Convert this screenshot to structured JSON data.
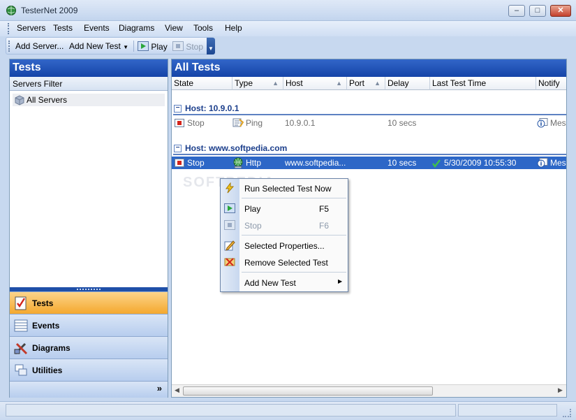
{
  "window": {
    "title": "TesterNet 2009",
    "min_label": "–",
    "max_label": "□",
    "close_label": "✕"
  },
  "menubar": {
    "items": [
      {
        "label": "Servers"
      },
      {
        "label": "Tests"
      },
      {
        "label": "Events"
      },
      {
        "label": "Diagrams"
      },
      {
        "label": "View"
      },
      {
        "label": "Tools"
      },
      {
        "label": "Help"
      }
    ]
  },
  "toolbar": {
    "add_server": "Add Server...",
    "add_new_test": "Add New Test",
    "play": "Play",
    "stop": "Stop"
  },
  "left_panel": {
    "title": "Tests",
    "filter_label": "Servers Filter",
    "tree_items": [
      {
        "label": "All Servers"
      }
    ],
    "nav": [
      {
        "label": "Tests",
        "active": true
      },
      {
        "label": "Events"
      },
      {
        "label": "Diagrams"
      },
      {
        "label": "Utilities"
      }
    ],
    "more_glyph": "»"
  },
  "main_panel": {
    "title": "All Tests",
    "columns": [
      "State",
      "Type",
      "Host",
      "Port",
      "Delay",
      "Last Test Time",
      "Notify"
    ],
    "groups": [
      {
        "label": "Host: 10.9.0.1",
        "rows": [
          {
            "state": "Stop",
            "type": "Ping",
            "host": "10.9.0.1",
            "port": "",
            "delay": "10 secs",
            "last_test_time": "",
            "notify": "Mess"
          }
        ]
      },
      {
        "label": "Host: www.softpedia.com",
        "rows": [
          {
            "state": "Stop",
            "type": "Http",
            "host": "www.softpedia...",
            "port": "",
            "delay": "10 secs",
            "last_test_time": "5/30/2009 10:55:30",
            "notify": "Mess"
          }
        ]
      }
    ],
    "group_toggle": "−"
  },
  "watermark": "SOFTPEDIA",
  "context_menu": {
    "items": [
      {
        "label": "Run Selected Test Now",
        "key": ""
      },
      {
        "label": "Play",
        "key": "F5"
      },
      {
        "label": "Stop",
        "key": "F6"
      },
      {
        "label": "Selected Properties...",
        "key": ""
      },
      {
        "label": "Remove Selected Test",
        "key": ""
      },
      {
        "label": "Add New Test",
        "key": ""
      }
    ]
  },
  "colors": {
    "header_blue": "#1544a8",
    "selection_blue": "#2d67c7",
    "active_nav_orange": "#f4a82e"
  }
}
